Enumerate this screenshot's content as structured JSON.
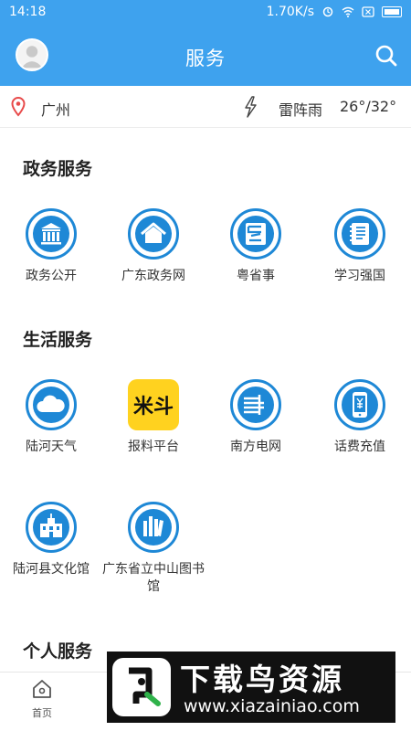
{
  "status_bar": {
    "time": "14:18",
    "speed": "1.70K/s"
  },
  "header": {
    "title": "服务"
  },
  "weather": {
    "city": "广州",
    "condition": "雷阵雨",
    "temperature": "26°/32°"
  },
  "sections": {
    "gov": {
      "title": "政务服务",
      "items": [
        "政务公开",
        "广东政务网",
        "粤省事",
        "学习强国"
      ]
    },
    "life": {
      "title": "生活服务",
      "items": [
        "陆河天气",
        "报料平台",
        "南方电网",
        "话费充值",
        "陆河县文化馆",
        "广东省立中山图书馆"
      ],
      "baoliao_icon_text": "米斗"
    },
    "personal": {
      "title": "个人服务"
    }
  },
  "bottom_nav": {
    "home": "首页"
  },
  "watermark": {
    "title": "下载鸟资源",
    "url": "www.xiazainiao.com"
  },
  "icons": {
    "avatar": "user-avatar",
    "search": "search-icon",
    "location": "location-pin-icon",
    "weather": "lightning-icon",
    "home": "home-icon"
  },
  "colors": {
    "primary": "#3ea2ee",
    "icon_blue": "#1e88d6",
    "location_red": "#e84a4a",
    "baoliao_yellow": "#ffd21f"
  }
}
